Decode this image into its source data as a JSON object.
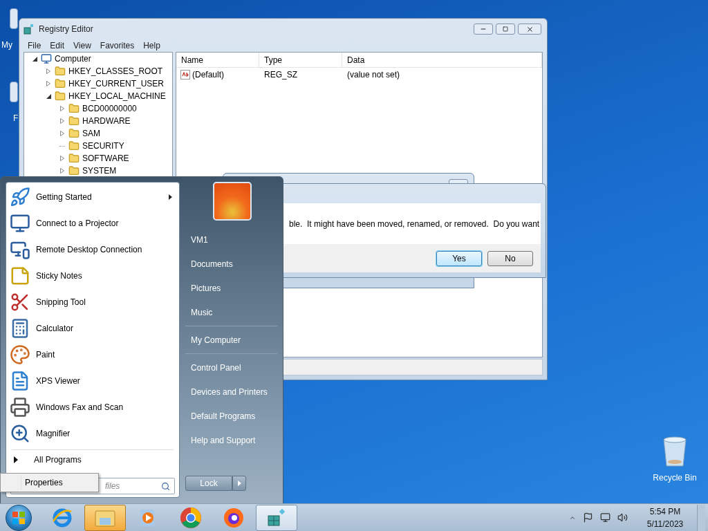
{
  "desktop": {
    "icons": [
      {
        "label": "My"
      },
      {
        "label": "F"
      }
    ],
    "recycle_bin": {
      "label": "Recycle Bin"
    }
  },
  "registry_editor": {
    "title": "Registry Editor",
    "menu": [
      "File",
      "Edit",
      "View",
      "Favorites",
      "Help"
    ],
    "tree": [
      {
        "label": "Computer",
        "expanded": true,
        "leaf": false,
        "children": [
          {
            "label": "HKEY_CLASSES_ROOT",
            "expanded": false,
            "leaf": false
          },
          {
            "label": "HKEY_CURRENT_USER",
            "expanded": false,
            "leaf": false
          },
          {
            "label": "HKEY_LOCAL_MACHINE",
            "expanded": true,
            "leaf": false,
            "children": [
              {
                "label": "BCD00000000",
                "expanded": false,
                "leaf": false
              },
              {
                "label": "HARDWARE",
                "expanded": false,
                "leaf": false
              },
              {
                "label": "SAM",
                "expanded": false,
                "leaf": false
              },
              {
                "label": "SECURITY",
                "expanded": false,
                "leaf": true
              },
              {
                "label": "SOFTWARE",
                "expanded": false,
                "leaf": false
              },
              {
                "label": "SYSTEM",
                "expanded": false,
                "leaf": false
              }
            ]
          }
        ]
      }
    ],
    "columns": [
      "Name",
      "Type",
      "Data"
    ],
    "rows": [
      {
        "name": "(Default)",
        "type": "REG_SZ",
        "data": "(value not set)"
      }
    ]
  },
  "dialog": {
    "message": "ble.  It might have been moved, renamed, or removed.  Do you want",
    "buttons": [
      {
        "label": "Yes",
        "selected": true
      },
      {
        "label": "No",
        "selected": false
      }
    ]
  },
  "start_menu": {
    "programs": [
      {
        "label": "Getting Started",
        "submenu": true
      },
      {
        "label": "Connect to a Projector",
        "submenu": false
      },
      {
        "label": "Remote Desktop Connection",
        "submenu": false
      },
      {
        "label": "Sticky Notes",
        "submenu": false
      },
      {
        "label": "Snipping Tool",
        "submenu": false
      },
      {
        "label": "Calculator",
        "submenu": false
      },
      {
        "label": "Paint",
        "submenu": false
      },
      {
        "label": "XPS Viewer",
        "submenu": false
      },
      {
        "label": "Windows Fax and Scan",
        "submenu": false
      },
      {
        "label": "Magnifier",
        "submenu": false
      }
    ],
    "all_programs": "All Programs",
    "search_placeholder": "files",
    "places": [
      [
        "VM1",
        "Documents",
        "Pictures",
        "Music"
      ],
      [
        "My Computer"
      ],
      [
        "Control Panel",
        "Devices and Printers",
        "Default Programs",
        "Help and Support"
      ]
    ],
    "shutdown": "Lock"
  },
  "context_menu": [
    "Properties"
  ],
  "taskbar": {
    "apps": [
      {
        "highlighted": false,
        "active": false
      },
      {
        "highlighted": true,
        "active": false
      },
      {
        "highlighted": false,
        "active": false
      },
      {
        "highlighted": false,
        "active": false
      },
      {
        "highlighted": false,
        "active": false
      },
      {
        "highlighted": false,
        "active": true
      }
    ],
    "time": "5:54 PM",
    "date": "5/11/2023"
  }
}
